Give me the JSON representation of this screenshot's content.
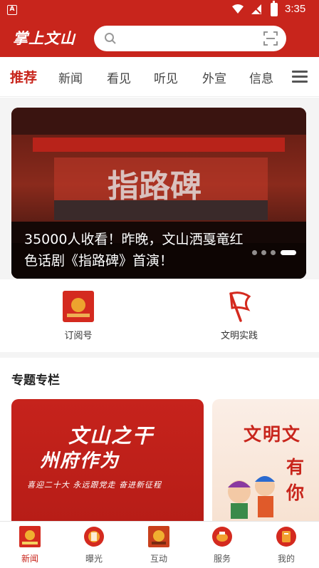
{
  "status_bar": {
    "time": "3:35",
    "notification_letter": "A"
  },
  "header": {
    "logo_text": "掌上文山",
    "search": {
      "placeholder": ""
    }
  },
  "tabs": [
    {
      "label": "推荐",
      "active": true
    },
    {
      "label": "新闻"
    },
    {
      "label": "看见"
    },
    {
      "label": "听见"
    },
    {
      "label": "外宣"
    },
    {
      "label": "信息"
    }
  ],
  "banner": {
    "headline": "35000人收看！昨晚，文山洒戛竜红色话剧《指路碑》首演！",
    "slide_count": 4,
    "active_slide": 4
  },
  "shortcuts": [
    {
      "label": "订阅号",
      "icon": "subscription-icon"
    },
    {
      "label": "文明实践",
      "icon": "red-flag-icon"
    }
  ],
  "special_column": {
    "title": "专题专栏",
    "cards": [
      {
        "line1": "文山之干",
        "line2": "州府作为",
        "subtitle": "喜迎二十大 永远跟党走 奋进新征程"
      },
      {
        "line1": "文明文",
        "line2": "有你"
      }
    ]
  },
  "bottom_nav": [
    {
      "label": "新闻",
      "icon": "news-icon",
      "active": true
    },
    {
      "label": "曝光",
      "icon": "exposure-icon"
    },
    {
      "label": "互动",
      "icon": "interaction-icon"
    },
    {
      "label": "服务",
      "icon": "service-icon"
    },
    {
      "label": "我的",
      "icon": "profile-icon"
    }
  ],
  "colors": {
    "brand_red": "#c8251c",
    "page_bg": "#f4f4f4"
  }
}
